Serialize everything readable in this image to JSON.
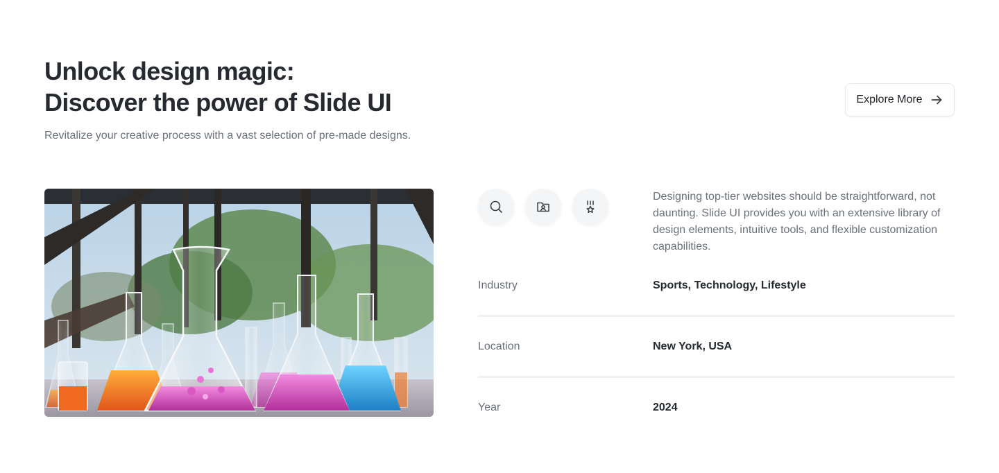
{
  "header": {
    "title_line1": "Unlock design magic:",
    "title_line2": "Discover the power of Slide UI",
    "subtitle": "Revitalize your creative process with a vast selection of pre-made designs.",
    "explore_label": "Explore More",
    "explore_icon": "arrow-right-icon"
  },
  "feature_icons": [
    {
      "name": "search-icon"
    },
    {
      "name": "portfolio-folder-icon"
    },
    {
      "name": "award-medal-icon"
    }
  ],
  "description": "Designing top-tier websites should be straightforward, not daunting. Slide UI provides you with an extensive library of design elements, intuitive tools, and flexible customization capabilities.",
  "details": [
    {
      "label": "Industry",
      "value": "Sports, Technology, Lifestyle"
    },
    {
      "label": "Location",
      "value": "New York, USA"
    },
    {
      "label": "Year",
      "value": "2024"
    }
  ],
  "image": {
    "subject": "laboratory-flasks-photo",
    "liquid_colors": [
      "#f07a2a",
      "#d54fb8",
      "#2ea3e0"
    ]
  }
}
